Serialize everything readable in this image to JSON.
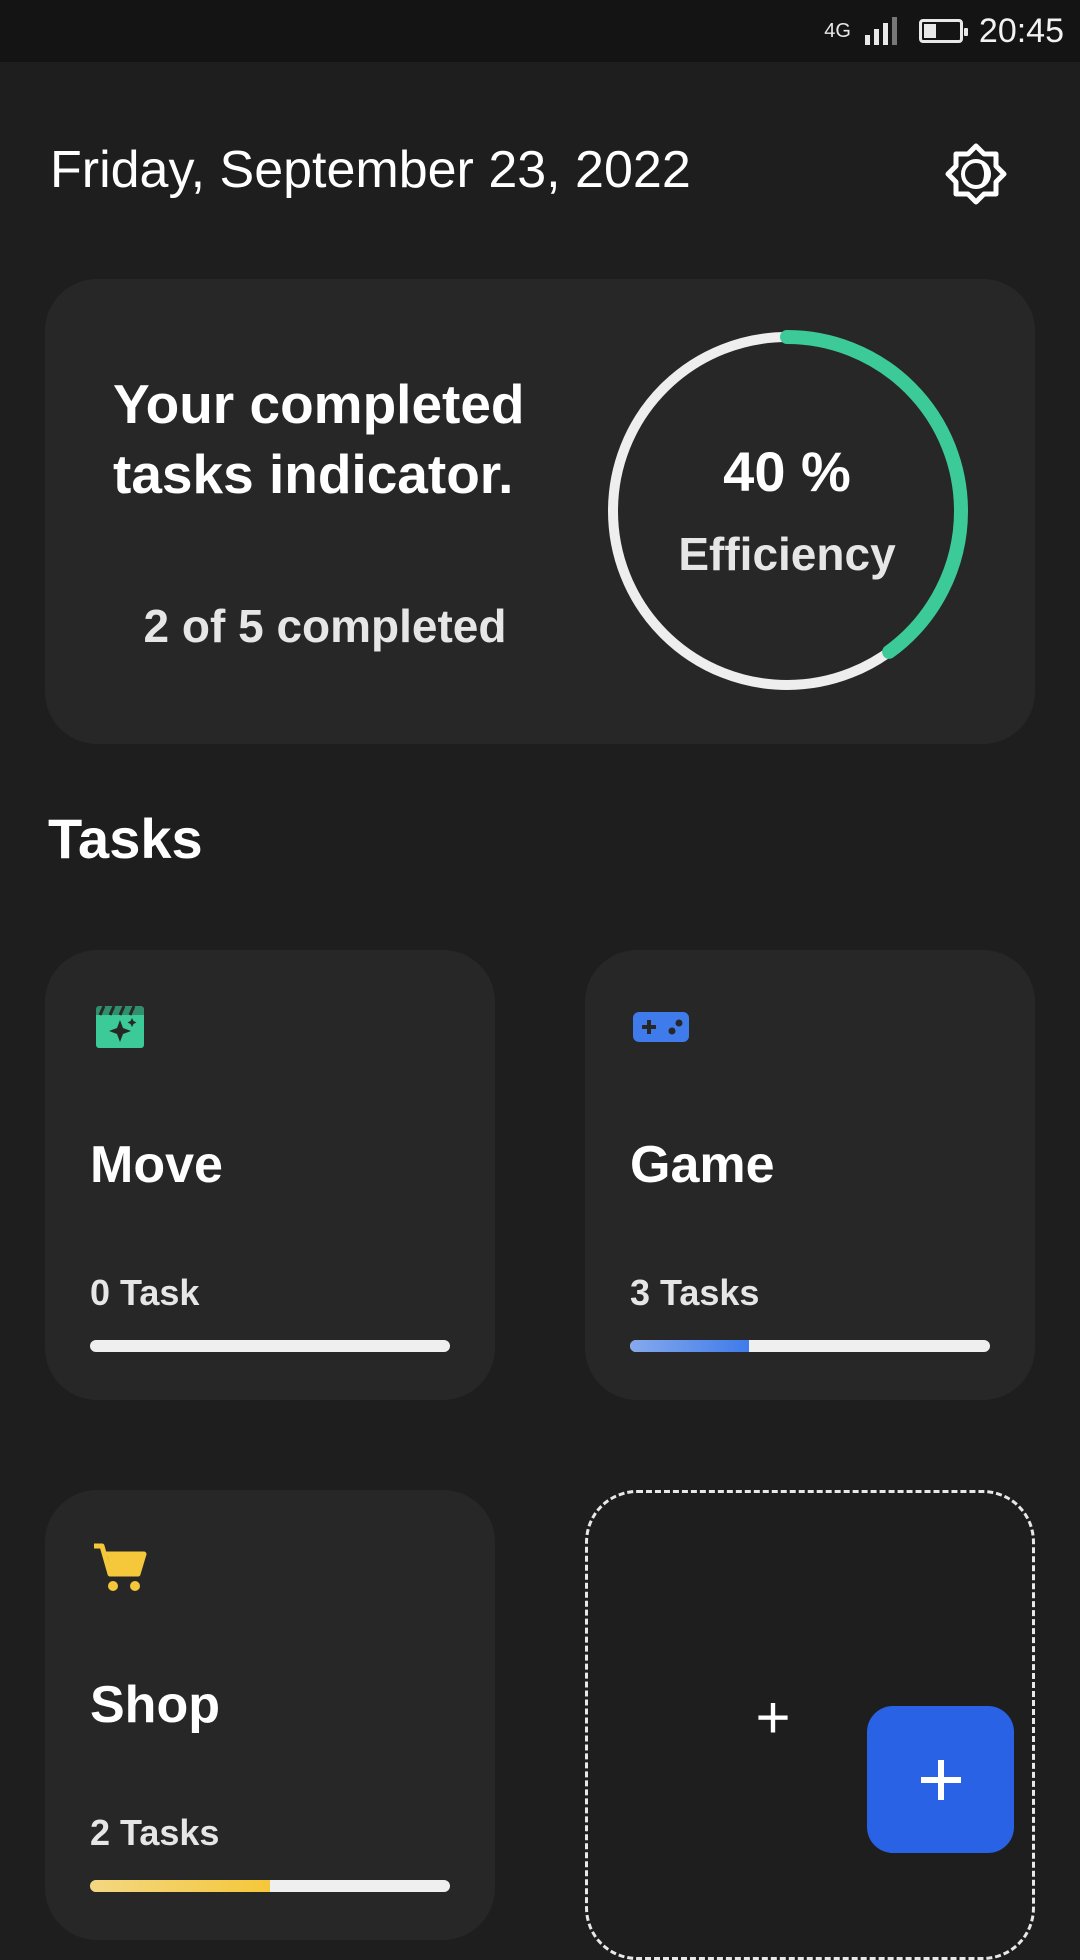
{
  "status_bar": {
    "network": "4G",
    "time": "20:45"
  },
  "header": {
    "date": "Friday, September 23, 2022"
  },
  "summary": {
    "title_line1": "Your completed",
    "title_line2": "tasks indicator.",
    "completed_text": "2 of 5 completed",
    "efficiency_value": "40 %",
    "efficiency_label": "Efficiency",
    "progress_fraction": 0.4,
    "ring_color": "#3ccb98",
    "track_color": "#eeeeee"
  },
  "tasks_section": {
    "title": "Tasks",
    "categories": [
      {
        "name": "Move",
        "count_text": "0 Task",
        "icon": "movie-icon",
        "color": "#3ccb98",
        "progress": 0.0
      },
      {
        "name": "Game",
        "count_text": "3 Tasks",
        "icon": "gamepad-icon",
        "color": "#3f7bea",
        "progress": 0.33
      },
      {
        "name": "Shop",
        "count_text": "2 Tasks",
        "icon": "cart-icon",
        "color": "#f5c73a",
        "progress": 0.5
      }
    ],
    "add_card_symbol": "+",
    "fab_symbol": "+"
  }
}
